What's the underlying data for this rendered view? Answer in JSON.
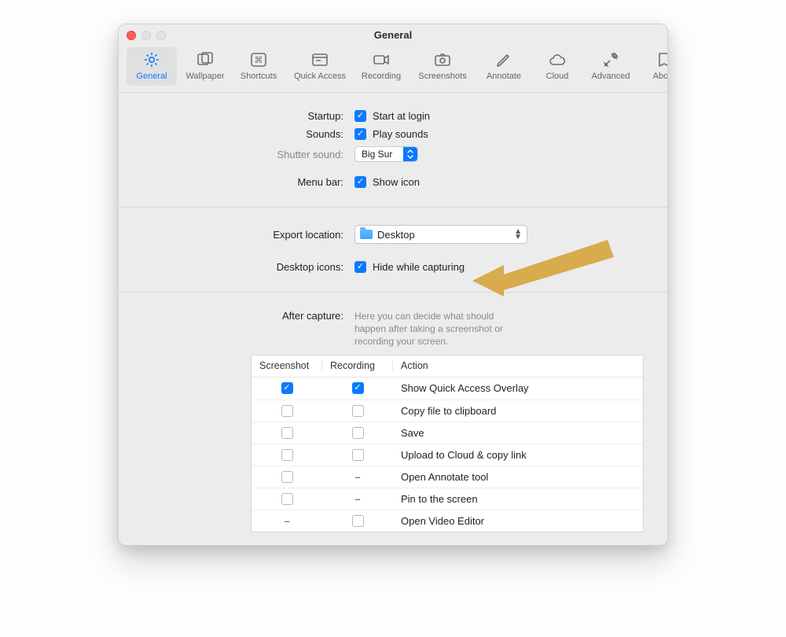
{
  "window": {
    "title": "General"
  },
  "toolbar": {
    "items": [
      {
        "id": "general",
        "label": "General",
        "active": true
      },
      {
        "id": "wallpaper",
        "label": "Wallpaper",
        "active": false
      },
      {
        "id": "shortcuts",
        "label": "Shortcuts",
        "active": false
      },
      {
        "id": "quick-access",
        "label": "Quick Access",
        "active": false,
        "wide": true
      },
      {
        "id": "recording",
        "label": "Recording",
        "active": false
      },
      {
        "id": "screenshots",
        "label": "Screenshots",
        "active": false,
        "wide": true
      },
      {
        "id": "annotate",
        "label": "Annotate",
        "active": false
      },
      {
        "id": "cloud",
        "label": "Cloud",
        "active": false
      },
      {
        "id": "advanced",
        "label": "Advanced",
        "active": false
      },
      {
        "id": "about",
        "label": "About",
        "active": false
      }
    ]
  },
  "startup": {
    "label": "Startup:",
    "start_at_login": {
      "checked": true,
      "text": "Start at login"
    }
  },
  "sounds": {
    "label": "Sounds:",
    "play_sounds": {
      "checked": true,
      "text": "Play sounds"
    },
    "shutter_label": "Shutter sound:",
    "shutter_value": "Big Sur"
  },
  "menubar": {
    "label": "Menu bar:",
    "show_icon": {
      "checked": true,
      "text": "Show icon"
    }
  },
  "export": {
    "label": "Export location:",
    "value": "Desktop"
  },
  "desktop_icons": {
    "label": "Desktop icons:",
    "hide": {
      "checked": true,
      "text": "Hide while capturing"
    }
  },
  "after_capture": {
    "label": "After capture:",
    "hint": "Here you can decide what should happen after taking a screenshot or recording your screen."
  },
  "actions_table": {
    "headers": {
      "screenshot": "Screenshot",
      "recording": "Recording",
      "action": "Action"
    },
    "rows": [
      {
        "screenshot": "checked",
        "recording": "checked",
        "action": "Show Quick Access Overlay"
      },
      {
        "screenshot": "unchecked",
        "recording": "unchecked",
        "action": "Copy file to clipboard"
      },
      {
        "screenshot": "unchecked",
        "recording": "unchecked",
        "action": "Save"
      },
      {
        "screenshot": "unchecked",
        "recording": "unchecked",
        "action": "Upload to Cloud & copy link"
      },
      {
        "screenshot": "unchecked",
        "recording": "dash",
        "action": "Open Annotate tool"
      },
      {
        "screenshot": "unchecked",
        "recording": "dash",
        "action": "Pin to the screen"
      },
      {
        "screenshot": "dash",
        "recording": "unchecked",
        "action": "Open Video Editor"
      }
    ]
  },
  "annotation": {
    "arrow_color": "#d8ab4d"
  }
}
